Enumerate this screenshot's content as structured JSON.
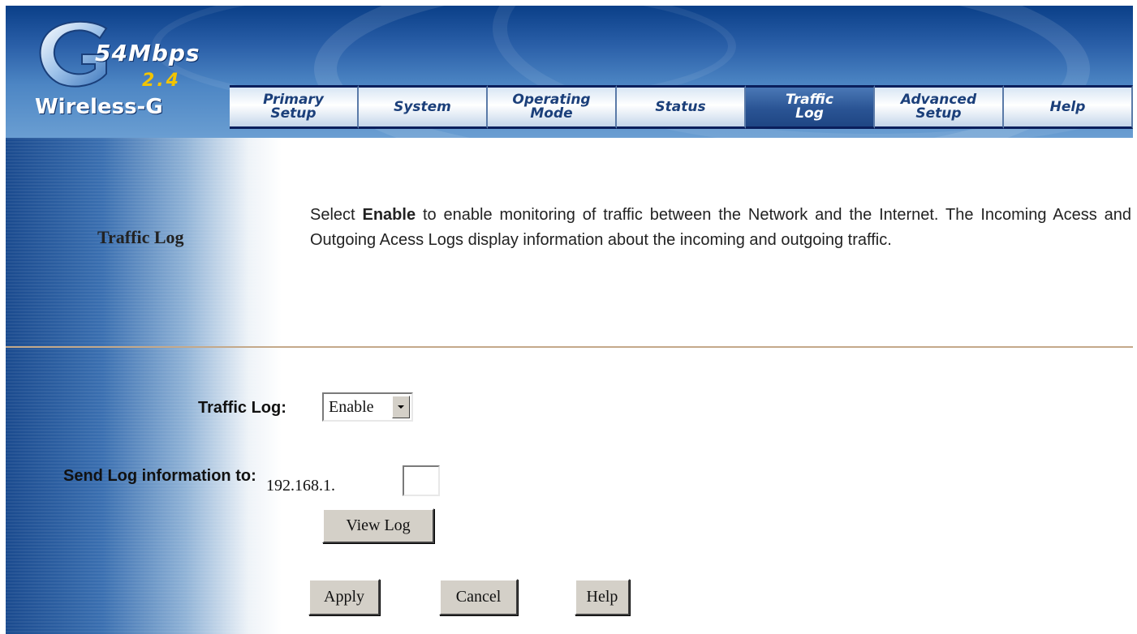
{
  "header": {
    "logo": {
      "speed": "54Mbps",
      "band": "2.4",
      "product": "Wireless-G",
      "icon": "wireless-g-logo-icon"
    },
    "tabs": [
      {
        "label": "Primary\nSetup",
        "active": false
      },
      {
        "label": "System",
        "active": false
      },
      {
        "label": "Operating\nMode",
        "active": false
      },
      {
        "label": "Status",
        "active": false
      },
      {
        "label": "Traffic\nLog",
        "active": true
      },
      {
        "label": "Advanced\nSetup",
        "active": false
      },
      {
        "label": "Help",
        "active": false
      }
    ]
  },
  "section": {
    "title": "Traffic Log",
    "description_pre": "Select ",
    "description_bold": "Enable",
    "description_post": " to enable monitoring of traffic between the Network and the Internet. The Incoming Acess and Outgoing Acess Logs display information about the incoming and outgoing traffic."
  },
  "form": {
    "traffic_log_label": "Traffic Log:",
    "traffic_log_value": "Enable",
    "send_log_label": "Send Log information to:",
    "ip_prefix": "192.168.1.",
    "ip_last_octet": ""
  },
  "buttons": {
    "view_log": "View Log",
    "apply": "Apply",
    "cancel": "Cancel",
    "help": "Help"
  },
  "colors": {
    "active_tab": "#2a5494",
    "tab_text": "#1b3f7a",
    "tab_border": "#0a1f5c",
    "logo_band": "#f2c400",
    "divider": "#c4a98a"
  }
}
